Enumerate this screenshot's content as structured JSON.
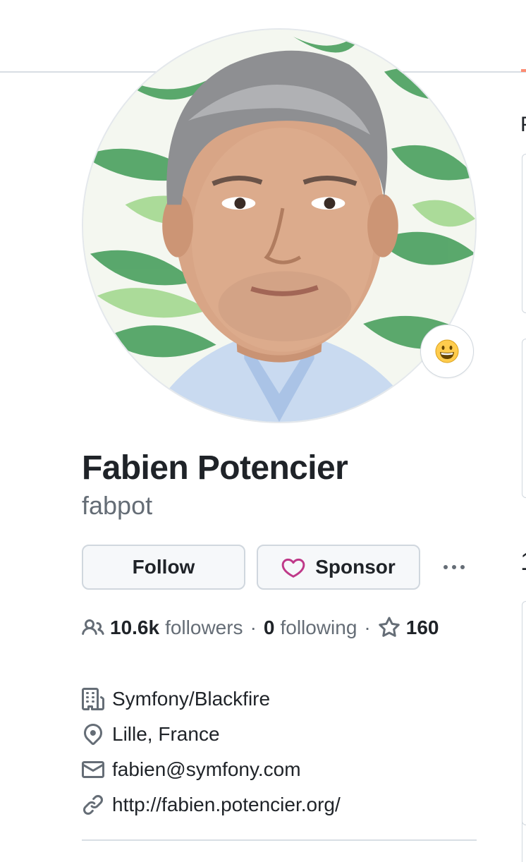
{
  "profile": {
    "name": "Fabien Potencier",
    "login": "fabpot",
    "status_emoji": "grinning-face-icon"
  },
  "actions": {
    "follow_label": "Follow",
    "sponsor_label": "Sponsor",
    "more_icon": "kebab-horizontal-icon"
  },
  "stats": {
    "followers_count": "10.6k",
    "followers_label": "followers",
    "following_count": "0",
    "following_label": "following",
    "separator": "·",
    "stars_count": "160"
  },
  "details": {
    "organization": "Symfony/Blackfire",
    "location": "Lille, France",
    "email": "fabien@symfony.com",
    "website": "http://fabien.potencier.org/"
  },
  "right_column": {
    "heading_fragment": "P",
    "mark_fragment": "1"
  },
  "colors": {
    "text_primary": "#1f2328",
    "text_muted": "#656d76",
    "border": "#d0d7de",
    "button_bg": "#f6f8fa",
    "sponsor_heart": "#bf3989",
    "tab_accent": "#fd8c73"
  }
}
